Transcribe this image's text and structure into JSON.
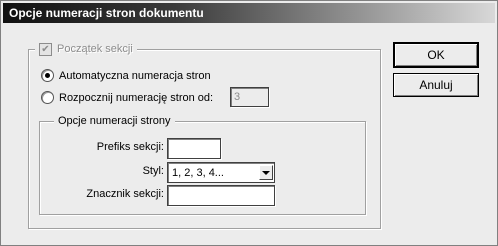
{
  "window": {
    "title": "Opcje numeracji stron dokumentu"
  },
  "section_start": {
    "label": "Początek sekcji",
    "checked": true,
    "disabled": true
  },
  "numbering": {
    "auto_label": "Automatyczna numeracja stron",
    "auto_selected": true,
    "start_label": "Rozpocznij numerację stron od:",
    "start_value": "3"
  },
  "page_options": {
    "legend": "Opcje numeracji strony",
    "prefix_label": "Prefiks sekcji:",
    "prefix_value": "",
    "style_label": "Styl:",
    "style_value": "1, 2, 3, 4...",
    "marker_label": "Znacznik sekcji:",
    "marker_value": ""
  },
  "buttons": {
    "ok": "OK",
    "cancel": "Anuluj"
  }
}
